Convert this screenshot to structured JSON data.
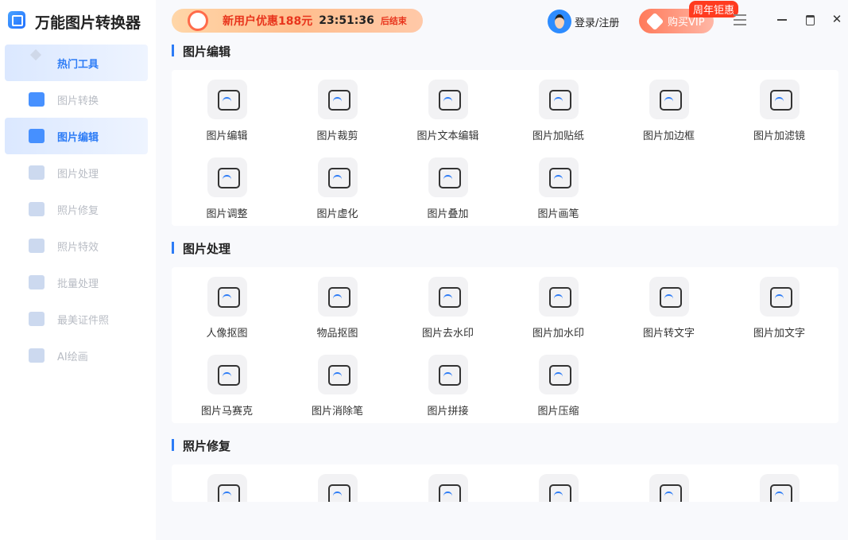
{
  "app": {
    "title": "万能图片转换器"
  },
  "sidebar": {
    "items": [
      {
        "label": "热门工具",
        "active": true
      },
      {
        "label": "图片转换"
      },
      {
        "label": "图片编辑",
        "active": true
      },
      {
        "label": "图片处理"
      },
      {
        "label": "照片修复"
      },
      {
        "label": "照片特效"
      },
      {
        "label": "批量处理"
      },
      {
        "label": "最美证件照"
      },
      {
        "label": "AI绘画"
      }
    ]
  },
  "header": {
    "promo_text": "新用户优惠188元",
    "countdown": "23:51:36",
    "promo_suffix": "后结束",
    "login": "登录/注册",
    "vip": "购买VIP",
    "vip_badge": "周年钜惠"
  },
  "sections": [
    {
      "title": "图片编辑",
      "tools": [
        "图片编辑",
        "图片裁剪",
        "图片文本编辑",
        "图片加贴纸",
        "图片加边框",
        "图片加滤镜",
        "图片调整",
        "图片虚化",
        "图片叠加",
        "图片画笔"
      ]
    },
    {
      "title": "图片处理",
      "tools": [
        "人像抠图",
        "物品抠图",
        "图片去水印",
        "图片加水印",
        "图片转文字",
        "图片加文字",
        "图片马赛克",
        "图片消除笔",
        "图片拼接",
        "图片压缩"
      ]
    },
    {
      "title": "照片修复",
      "tools": [
        "",
        "",
        "",
        "",
        "",
        ""
      ]
    }
  ],
  "colors": {
    "accent": "#2d7cf6",
    "promo_red": "#e8341c"
  }
}
